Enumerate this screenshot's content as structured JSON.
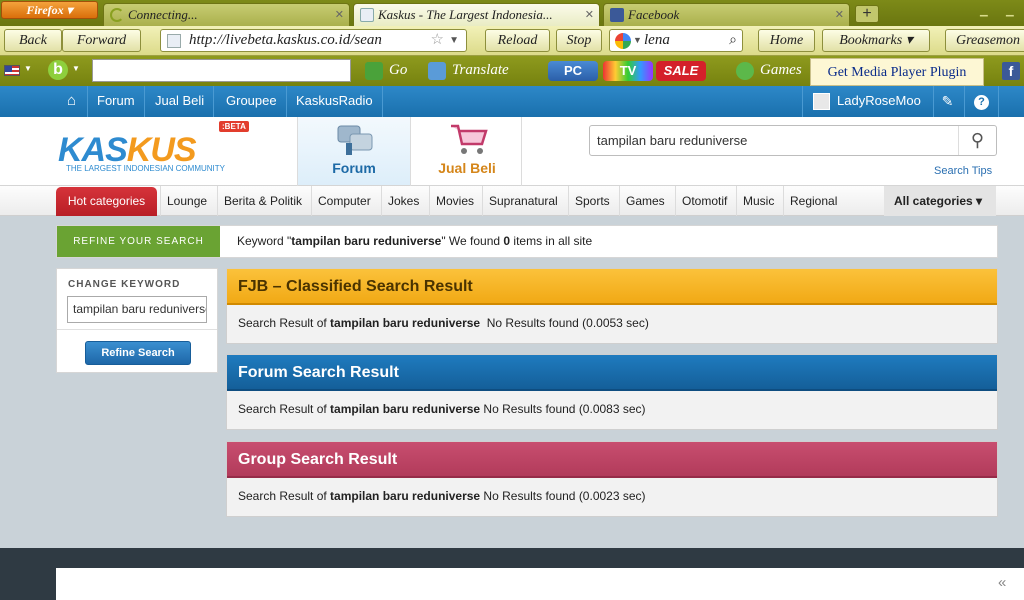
{
  "browser": {
    "menu_label": "Firefox ▾",
    "tabs": [
      {
        "title": "Connecting...",
        "fav_color": "#8aa020"
      },
      {
        "title": "Kaskus - The Largest Indonesia...",
        "fav_color": "#2e8bd0"
      },
      {
        "title": "Facebook",
        "fav_color": "#3b5998"
      }
    ],
    "tab_close": "✕",
    "new_tab": "+",
    "back": "Back",
    "forward": "Forward",
    "url": "http://livebeta.kaskus.co.id/sean",
    "reload": "Reload",
    "stop": "Stop",
    "search_value": "lena",
    "home": "Home",
    "bookmarks": "Bookmarks ▾",
    "greasemonkey": "Greasemon",
    "addons": {
      "go": "Go",
      "translate": "Translate",
      "pc": "PC",
      "tv": "TV",
      "sale": "SALE",
      "games": "Games",
      "media_player": "Get Media Player Plugin",
      "fb": "f"
    }
  },
  "topnav": {
    "items": [
      "Forum",
      "Jual Beli",
      "Groupee",
      "KaskusRadio"
    ],
    "user": "LadyRoseMoo"
  },
  "header": {
    "logo_text_a": "KAS",
    "logo_text_b": "KUS",
    "logo_tagline": "THE LARGEST INDONESIAN COMMUNITY",
    "beta": ":BETA",
    "forum_tile": "Forum",
    "jualbeli_tile": "Jual Beli",
    "search_value": "tampilan baru reduniverse",
    "search_tips": "Search Tips"
  },
  "categories": {
    "hot": "Hot categories",
    "items": [
      "Lounge",
      "Berita & Politik",
      "Computer",
      "Jokes",
      "Movies",
      "Supranatural",
      "Sports",
      "Games",
      "Otomotif",
      "Music",
      "Regional"
    ],
    "all": "All categories ▾"
  },
  "refine": {
    "label": "REFINE YOUR SEARCH",
    "prefix": "Keyword \"",
    "keyword": "tampilan baru reduniverse",
    "middle": "\" We found ",
    "count": "0",
    "suffix": " items in all site"
  },
  "sidebar": {
    "label": "CHANGE KEYWORD",
    "input_value": "tampilan baru reduniverse",
    "button": "Refine Search"
  },
  "results": [
    {
      "title": "FJB – Classified Search Result",
      "prefix": "Search Result of ",
      "keyword": "tampilan baru reduniverse",
      "status": "  No Results found (0.0053 sec)"
    },
    {
      "title": "Forum Search Result",
      "prefix": "Search Result of ",
      "keyword": "tampilan baru reduniverse",
      "status": " No Results found (0.0083 sec)"
    },
    {
      "title": "Group Search Result",
      "prefix": "Search Result of ",
      "keyword": "tampilan baru reduniverse",
      "status": " No Results found (0.0023 sec)"
    }
  ],
  "footer": {
    "collapse": "«"
  }
}
